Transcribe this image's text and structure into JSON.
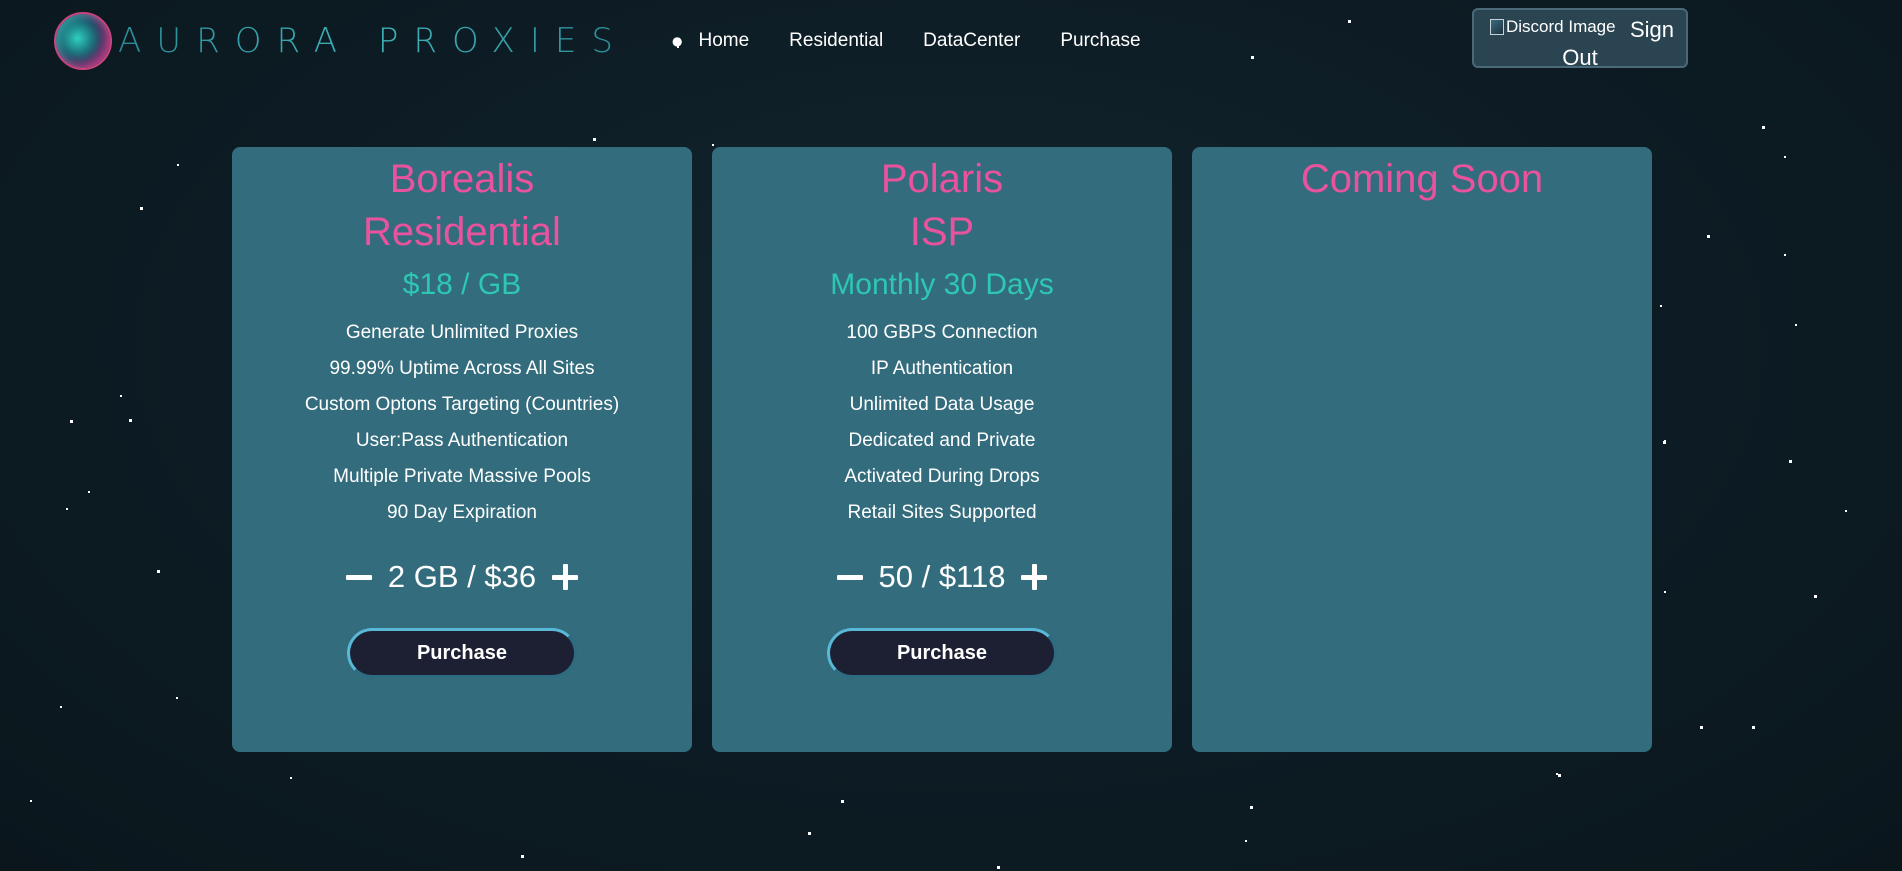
{
  "header": {
    "logo_text": "AURORA PROXIES",
    "nav_items": [
      "Home",
      "Residential",
      "DataCenter",
      "Purchase"
    ],
    "account": {
      "image_alt": "Discord Image",
      "sign_label": "Sign",
      "out_label": "Out"
    }
  },
  "cards": [
    {
      "title_line1": "Borealis",
      "title_line2": "Residential",
      "price": "$18 / GB",
      "features": [
        "Generate Unlimited Proxies",
        "99.99% Uptime Across All Sites",
        "Custom Optons Targeting (Countries)",
        "User:Pass Authentication",
        "Multiple Private Massive Pools",
        "90 Day Expiration"
      ],
      "quantity_display": "2 GB / $36",
      "purchase_label": "Purchase"
    },
    {
      "title_line1": "Polaris",
      "title_line2": "ISP",
      "price": "Monthly 30 Days",
      "features": [
        "100 GBPS Connection",
        "IP Authentication",
        "Unlimited Data Usage",
        "Dedicated and Private",
        "Activated During Drops",
        "Retail Sites Supported"
      ],
      "quantity_display": "50 / $118",
      "purchase_label": "Purchase"
    },
    {
      "title_line1": "Coming Soon"
    }
  ],
  "colors": {
    "background": "#0d1c24",
    "card": "#336c7d",
    "title_pink": "#e9539e",
    "price_teal": "#2ec7b4",
    "button_dark": "#1d1f33",
    "button_border": "#59b8d6"
  },
  "icons": {
    "decrement": "minus-icon",
    "increment": "plus-icon",
    "logo": "aurora-orb-icon",
    "broken_image": "broken-image-icon"
  }
}
